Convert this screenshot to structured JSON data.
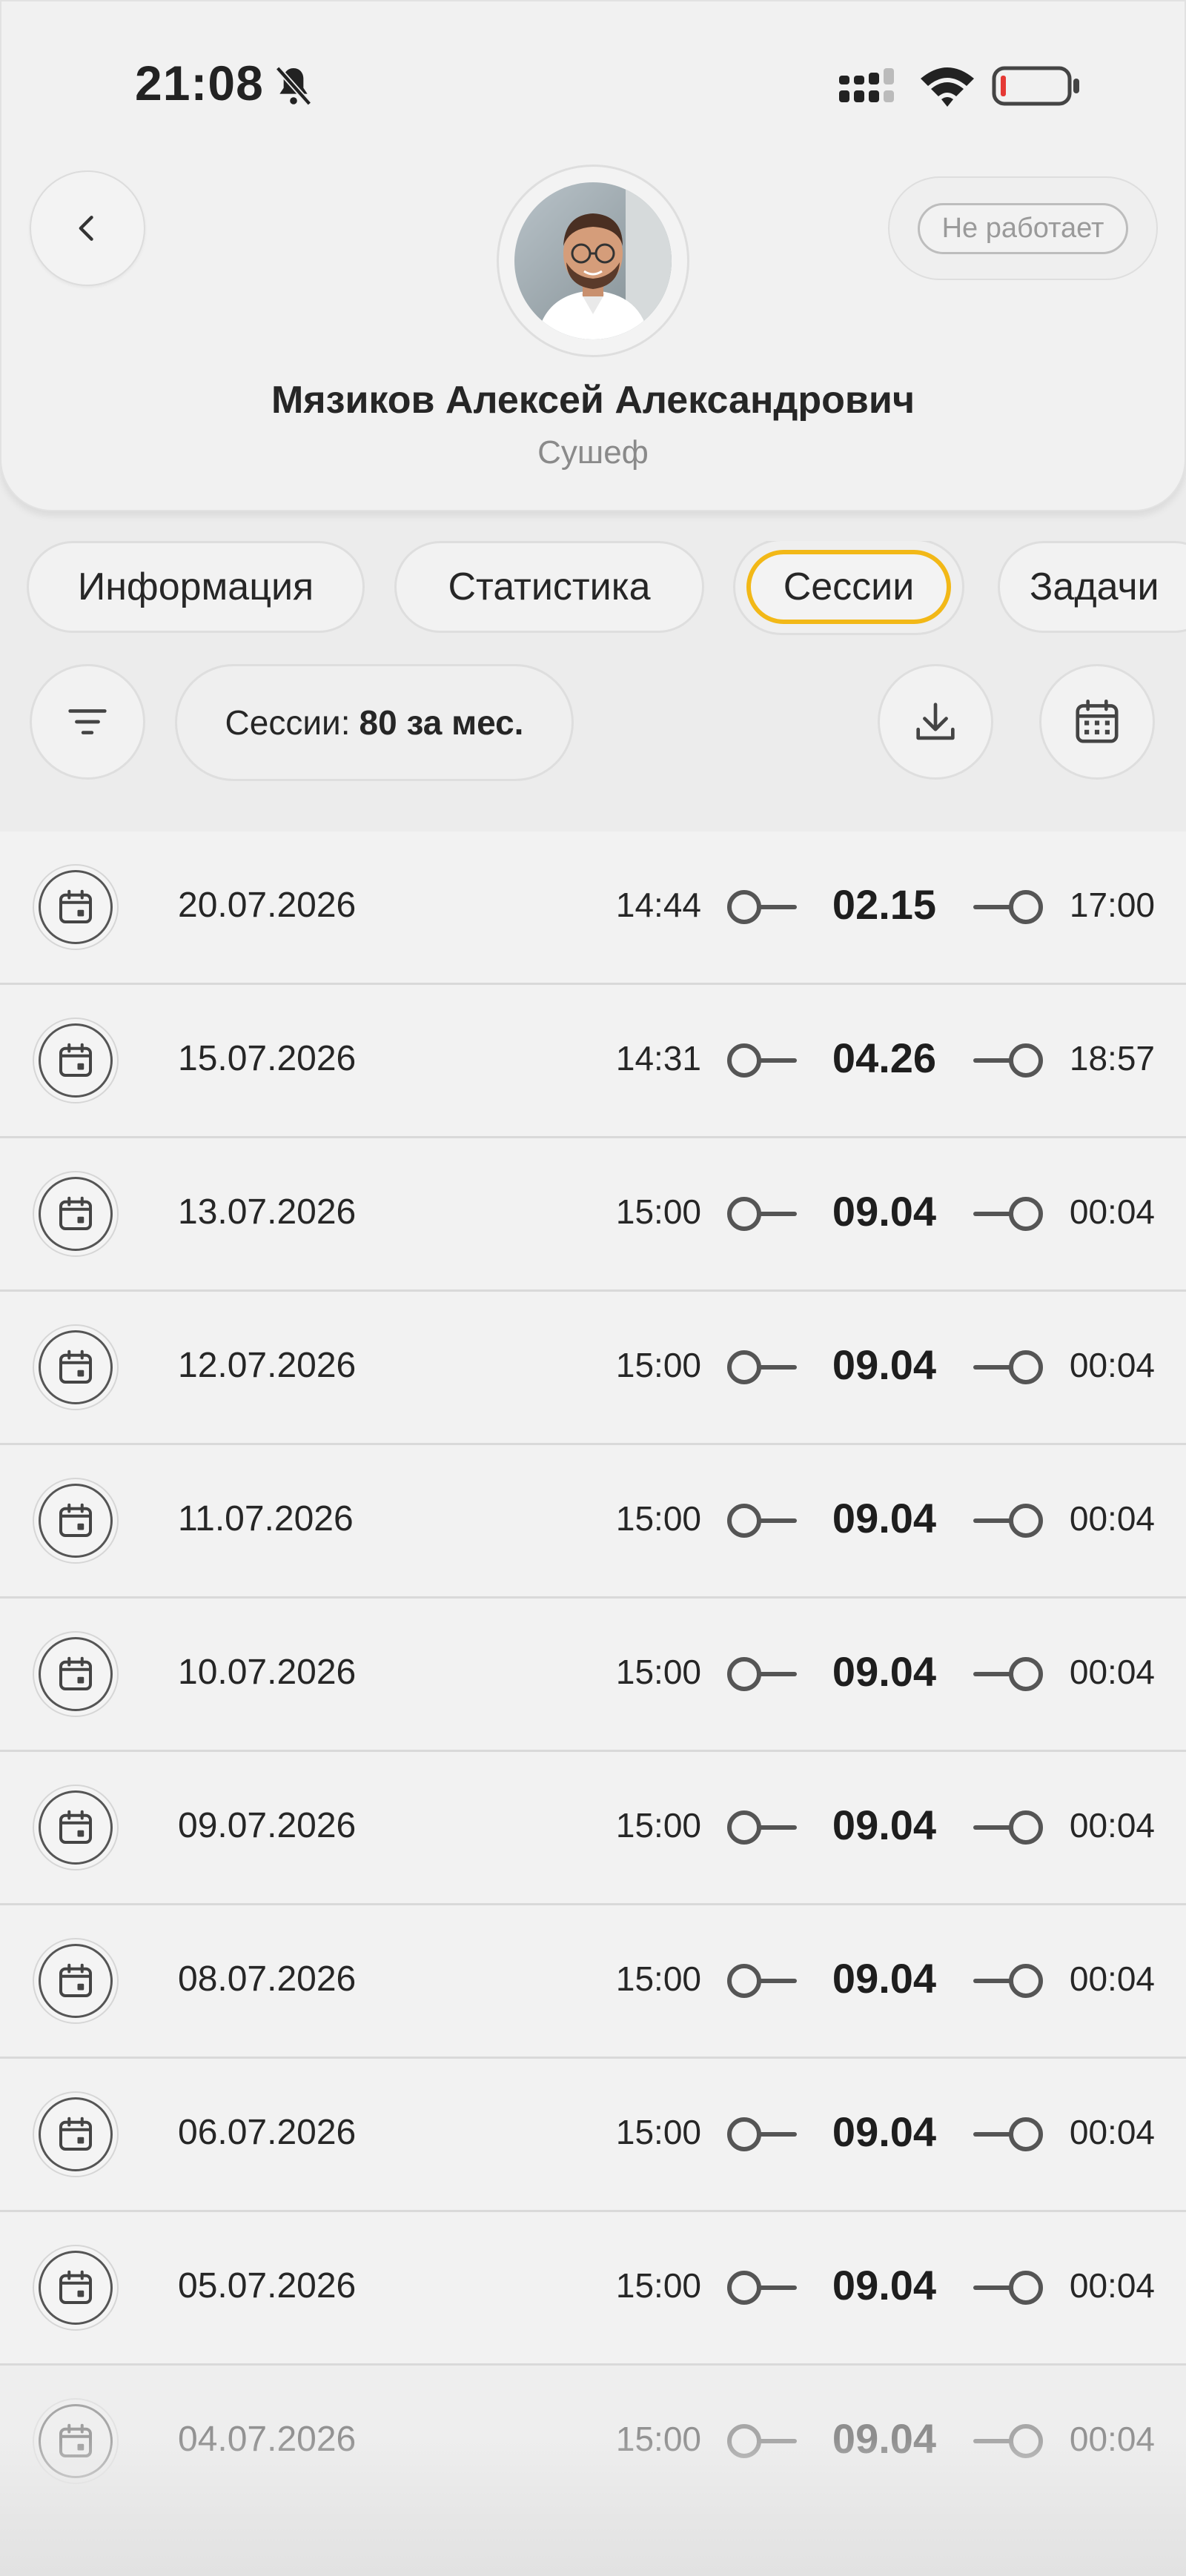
{
  "status_bar": {
    "time": "21:08",
    "battery_color": "#e53935"
  },
  "profile": {
    "name": "Мязиков Алексей Александрович",
    "role": "Сушеф",
    "work_status": "Не работает"
  },
  "tabs": [
    {
      "label": "Информация",
      "active": false
    },
    {
      "label": "Статистика",
      "active": false
    },
    {
      "label": "Сессии",
      "active": true
    },
    {
      "label": "Задачи",
      "active": false
    }
  ],
  "toolbar": {
    "sessions_label": "Сессии:",
    "sessions_count": "80 за мес.",
    "accent_color": "#f2b817"
  },
  "sessions": [
    {
      "date": "20.07.2026",
      "start": "14:44",
      "duration": "02.15",
      "end": "17:00"
    },
    {
      "date": "15.07.2026",
      "start": "14:31",
      "duration": "04.26",
      "end": "18:57"
    },
    {
      "date": "13.07.2026",
      "start": "15:00",
      "duration": "09.04",
      "end": "00:04"
    },
    {
      "date": "12.07.2026",
      "start": "15:00",
      "duration": "09.04",
      "end": "00:04"
    },
    {
      "date": "11.07.2026",
      "start": "15:00",
      "duration": "09.04",
      "end": "00:04"
    },
    {
      "date": "10.07.2026",
      "start": "15:00",
      "duration": "09.04",
      "end": "00:04"
    },
    {
      "date": "09.07.2026",
      "start": "15:00",
      "duration": "09.04",
      "end": "00:04"
    },
    {
      "date": "08.07.2026",
      "start": "15:00",
      "duration": "09.04",
      "end": "00:04"
    },
    {
      "date": "06.07.2026",
      "start": "15:00",
      "duration": "09.04",
      "end": "00:04"
    },
    {
      "date": "05.07.2026",
      "start": "15:00",
      "duration": "09.04",
      "end": "00:04"
    },
    {
      "date": "04.07.2026",
      "start": "15:00",
      "duration": "09.04",
      "end": "00:04"
    }
  ]
}
